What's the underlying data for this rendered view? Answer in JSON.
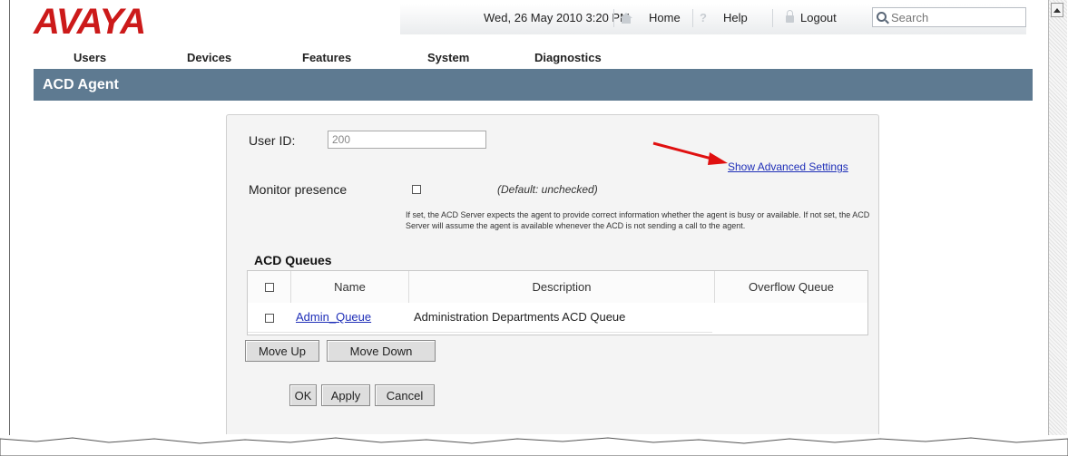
{
  "brand": {
    "logo_text": "AVAYA",
    "logo_color": "#cc1a1a"
  },
  "topbar": {
    "datetime": "Wed, 26 May 2010 3:20 PM",
    "home_label": "Home",
    "help_label": "Help",
    "logout_label": "Logout",
    "search_placeholder": "Search"
  },
  "nav": {
    "items": [
      "Users",
      "Devices",
      "Features",
      "System",
      "Diagnostics"
    ]
  },
  "page": {
    "title": "ACD Agent",
    "title_bar_color": "#5e7a91"
  },
  "form": {
    "user_id_label": "User ID:",
    "user_id_value": "200",
    "advanced_link": "Show Advanced Settings",
    "monitor_label": "Monitor presence",
    "monitor_checked": false,
    "monitor_default": "(Default: unchecked)",
    "monitor_help": "If set, the ACD Server expects the agent to provide correct information whether the agent is busy or available. If not set, the ACD Server will assume the agent is available whenever the ACD is not sending a call to the agent."
  },
  "queues": {
    "heading": "ACD Queues",
    "columns": [
      "Name",
      "Description",
      "Overflow Queue"
    ],
    "rows": [
      {
        "name": "Admin_Queue",
        "description": "Administration Departments ACD Queue",
        "overflow": ""
      }
    ]
  },
  "buttons": {
    "move_up": "Move Up",
    "move_down": "Move Down",
    "ok": "OK",
    "apply": "Apply",
    "cancel": "Cancel"
  },
  "annotation": {
    "arrow_color": "#e01010"
  }
}
